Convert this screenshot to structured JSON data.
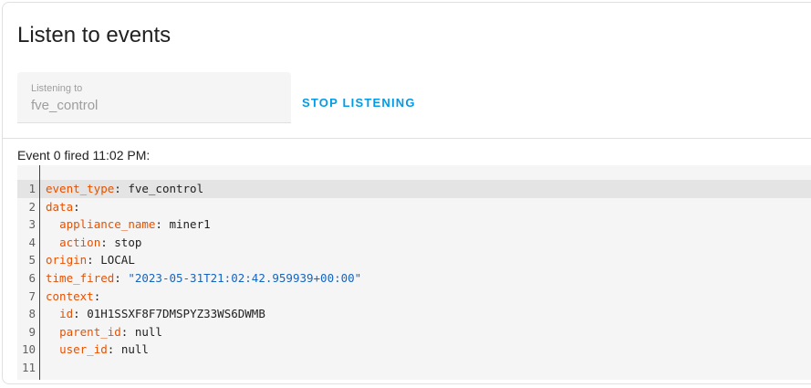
{
  "card": {
    "title": "Listen to events"
  },
  "listen_field": {
    "label": "Listening to",
    "value": "fve_control"
  },
  "stop_button": {
    "label": "STOP LISTENING"
  },
  "event": {
    "heading": "Event 0 fired 11:02 PM:",
    "lines": [
      {
        "num": "1",
        "indent": "",
        "key": "event_type",
        "sep": ": ",
        "value": "fve_control",
        "value_type": "plain"
      },
      {
        "num": "2",
        "indent": "",
        "key": "data",
        "sep": ":",
        "value": "",
        "value_type": "plain"
      },
      {
        "num": "3",
        "indent": "  ",
        "key": "appliance_name",
        "sep": ": ",
        "value": "miner1",
        "value_type": "plain"
      },
      {
        "num": "4",
        "indent": "  ",
        "key": "action",
        "sep": ": ",
        "value": "stop",
        "value_type": "plain"
      },
      {
        "num": "5",
        "indent": "",
        "key": "origin",
        "sep": ": ",
        "value": "LOCAL",
        "value_type": "plain"
      },
      {
        "num": "6",
        "indent": "",
        "key": "time_fired",
        "sep": ": ",
        "value": "\"2023-05-31T21:02:42.959939+00:00\"",
        "value_type": "string"
      },
      {
        "num": "7",
        "indent": "",
        "key": "context",
        "sep": ":",
        "value": "",
        "value_type": "plain"
      },
      {
        "num": "8",
        "indent": "  ",
        "key": "id",
        "sep": ": ",
        "value": "01H1SSXF8F7DMSPYZ33WS6DWMB",
        "value_type": "plain"
      },
      {
        "num": "9",
        "indent": "  ",
        "key": "parent_id",
        "sep": ": ",
        "value": "null",
        "value_type": "plain"
      },
      {
        "num": "10",
        "indent": "  ",
        "key": "user_id",
        "sep": ": ",
        "value": "null",
        "value_type": "plain"
      },
      {
        "num": "11",
        "indent": "",
        "key": "",
        "sep": "",
        "value": "",
        "value_type": "plain"
      }
    ]
  },
  "colors": {
    "accent": "#039be5",
    "yaml_key": "#e65100",
    "yaml_string": "#1565c0"
  }
}
